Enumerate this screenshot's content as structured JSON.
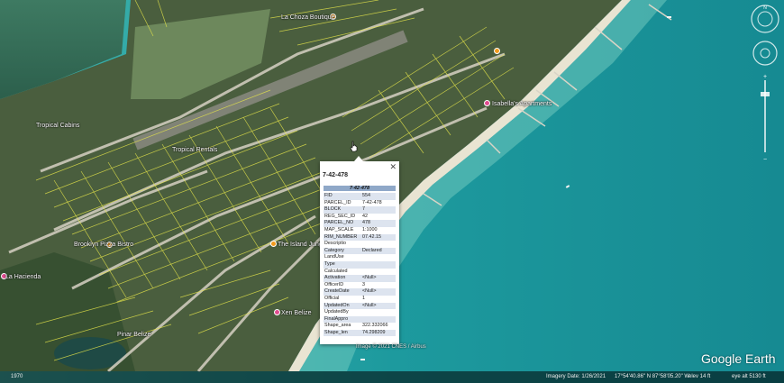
{
  "places": [
    {
      "key": "choza",
      "label": "La Choza Boutique"
    },
    {
      "key": "tropical",
      "label": "Tropical Rentals"
    },
    {
      "key": "apt",
      "label": "Isabella's Apartments"
    },
    {
      "key": "cabins",
      "label": "Tropical Cabins"
    },
    {
      "key": "brook",
      "label": "Brooklyn Pizza Bistro"
    },
    {
      "key": "hacienda",
      "label": "La Hacienda"
    },
    {
      "key": "island",
      "label": "The Island Jungle"
    },
    {
      "key": "belize",
      "label": "Pinar Belize"
    },
    {
      "key": "xen",
      "label": "Xen Belize"
    }
  ],
  "popup": {
    "title": "7-42-478",
    "header": "7-42-478",
    "close": "✕",
    "rows": [
      {
        "k": "FID",
        "v": "554"
      },
      {
        "k": "PARCEL_ID",
        "v": "7-42-478"
      },
      {
        "k": "BLOCK",
        "v": "7"
      },
      {
        "k": "REG_SEC_ID",
        "v": "42"
      },
      {
        "k": "PARCEL_NO",
        "v": "478"
      },
      {
        "k": "MAP_SCALE",
        "v": "1:1000"
      },
      {
        "k": "RIM_NUMBER",
        "v": "07.42.15"
      },
      {
        "k": "Descriptio",
        "v": ""
      },
      {
        "k": "Category",
        "v": "Declared"
      },
      {
        "k": "LandUse",
        "v": ""
      },
      {
        "k": "Type",
        "v": ""
      },
      {
        "k": "Calculated",
        "v": ""
      },
      {
        "k": "Activation",
        "v": "<Null>"
      },
      {
        "k": "OfficerID",
        "v": "3"
      },
      {
        "k": "CreateDate",
        "v": "<Null>"
      },
      {
        "k": "Official",
        "v": "1"
      },
      {
        "k": "UpdatedOn",
        "v": "<Null>"
      },
      {
        "k": "UpdatedBy",
        "v": ""
      },
      {
        "k": "FinalAppro",
        "v": ""
      },
      {
        "k": "Shape_area",
        "v": "322.332066"
      },
      {
        "k": "Shape_len",
        "v": "74.298209"
      }
    ]
  },
  "copyright": "Image © 2021 CNES / Airbus",
  "logo": "Google Earth",
  "status": {
    "year": "1970",
    "imagery_date": "Imagery Date: 1/26/2021",
    "coords": "17°54'40.86\" N   87°58'05.20\" W",
    "elev": "elev   14 ft",
    "eye_alt": "eye alt   5130 ft"
  },
  "colors": {
    "sea": "#1b9a9a",
    "land": "#3d5a3a",
    "parcel": "#e6e64a",
    "road": "#d8d4c6"
  }
}
